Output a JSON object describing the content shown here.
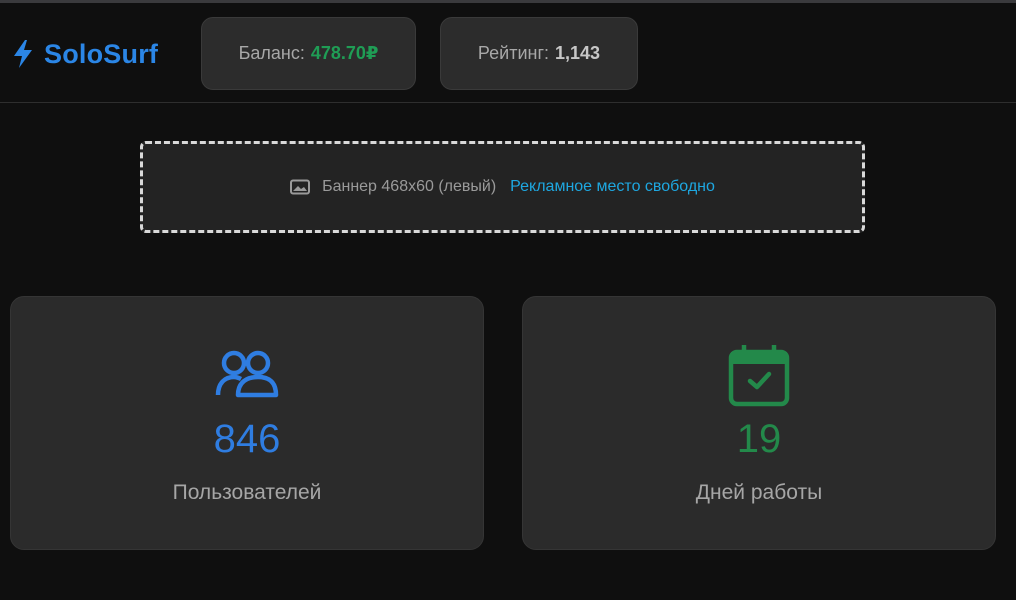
{
  "header": {
    "logo_text": "SoloSurf",
    "logo_icon": "bolt-icon",
    "balance_label": "Баланс:",
    "balance_value": "478.70₽",
    "rating_label": "Рейтинг:",
    "rating_value": "1,143"
  },
  "banner": {
    "icon": "image-icon",
    "text": "Баннер 468x60 (левый)",
    "link_text": "Рекламное место свободно"
  },
  "stats": {
    "users": {
      "icon": "users-icon",
      "value": "846",
      "label": "Пользователей"
    },
    "days": {
      "icon": "calendar-check-icon",
      "value": "19",
      "label": "Дней работы"
    }
  },
  "colors": {
    "accent_blue": "#2b86e6",
    "balance_green": "#1f9d55",
    "link_cyan": "#1ea7e0",
    "days_green": "#23894a"
  }
}
